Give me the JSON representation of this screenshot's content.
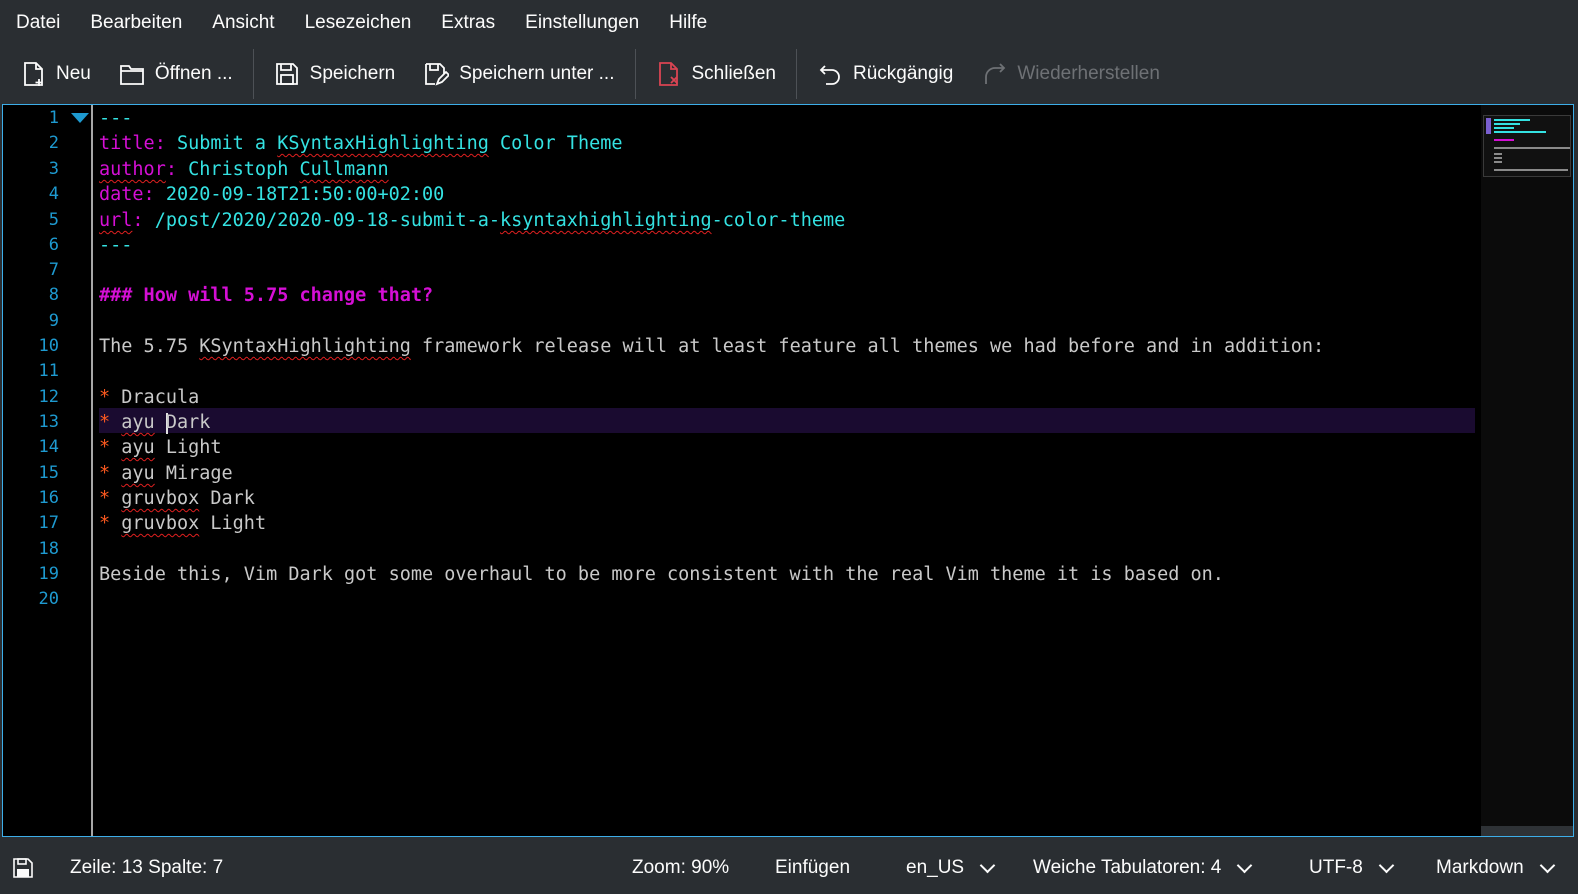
{
  "menubar": {
    "items": [
      "Datei",
      "Bearbeiten",
      "Ansicht",
      "Lesezeichen",
      "Extras",
      "Einstellungen",
      "Hilfe"
    ]
  },
  "toolbar": {
    "new_label": "Neu",
    "open_label": "Öffnen ...",
    "save_label": "Speichern",
    "save_as_label": "Speichern unter ...",
    "close_label": "Schließen",
    "undo_label": "Rückgängig",
    "redo_label": "Wiederherstellen"
  },
  "editor": {
    "line_numbers": [
      "1",
      "2",
      "3",
      "4",
      "5",
      "6",
      "7",
      "8",
      "9",
      "10",
      "11",
      "12",
      "13",
      "14",
      "15",
      "16",
      "17",
      "18",
      "19",
      "20"
    ],
    "current_line": 13,
    "lines": {
      "l1": "---",
      "l2_key": "title:",
      "l2_val": " Submit a ",
      "l2_word": "KSyntaxHighlighting",
      "l2_rest": " Color Theme",
      "l3_key": "author",
      "l3_colon": ":",
      "l3_val": " Christoph ",
      "l3_word": "Cullmann",
      "l4_key": "date:",
      "l4_val": " 2020-09-18T21:50:00+02:00",
      "l5_key": "url",
      "l5_colon": ":",
      "l5_val": " /post/2020/2020-09-18-submit-a-",
      "l5_word": "ksyntaxhighlighting",
      "l5_rest": "-color-theme",
      "l6": "---",
      "l8": "### How will 5.75 change that?",
      "l10_a": "The 5.75 ",
      "l10_word": "KSyntaxHighlighting",
      "l10_b": " framework release will at least feature all themes we had before and in addition:",
      "bullet": "*",
      "l12": " Dracula",
      "l13_word": "ayu",
      "l13_a": " ",
      "l13_b": "Dark",
      "l14_word": "ayu",
      "l14_rest": " Light",
      "l15_word": "ayu",
      "l15_rest": " Mirage",
      "l16_word": "gruvbox",
      "l16_rest": " Dark",
      "l17_word": "gruvbox",
      "l17_rest": " Light",
      "l19": "Beside this, Vim Dark got some overhaul to be more consistent with the real Vim theme it is based on."
    }
  },
  "statusbar": {
    "position": "Zeile: 13 Spalte: 7",
    "zoom": "Zoom: 90%",
    "mode": "Einfügen",
    "dictionary": "en_US",
    "indent": "Weiche Tabulatoren: 4",
    "encoding": "UTF-8",
    "syntax": "Markdown"
  },
  "colors": {
    "accent": "#3daee9",
    "key": "#d50fd5",
    "value": "#34e2e2",
    "bullet": "#ff5a1f",
    "line_number": "#1e9ad0",
    "current_line": "#1a0b30"
  },
  "icons": [
    "document-new-icon",
    "folder-open-icon",
    "save-icon",
    "save-as-icon",
    "close-document-icon",
    "undo-icon",
    "redo-icon",
    "disk-icon",
    "fold-arrow-icon"
  ]
}
